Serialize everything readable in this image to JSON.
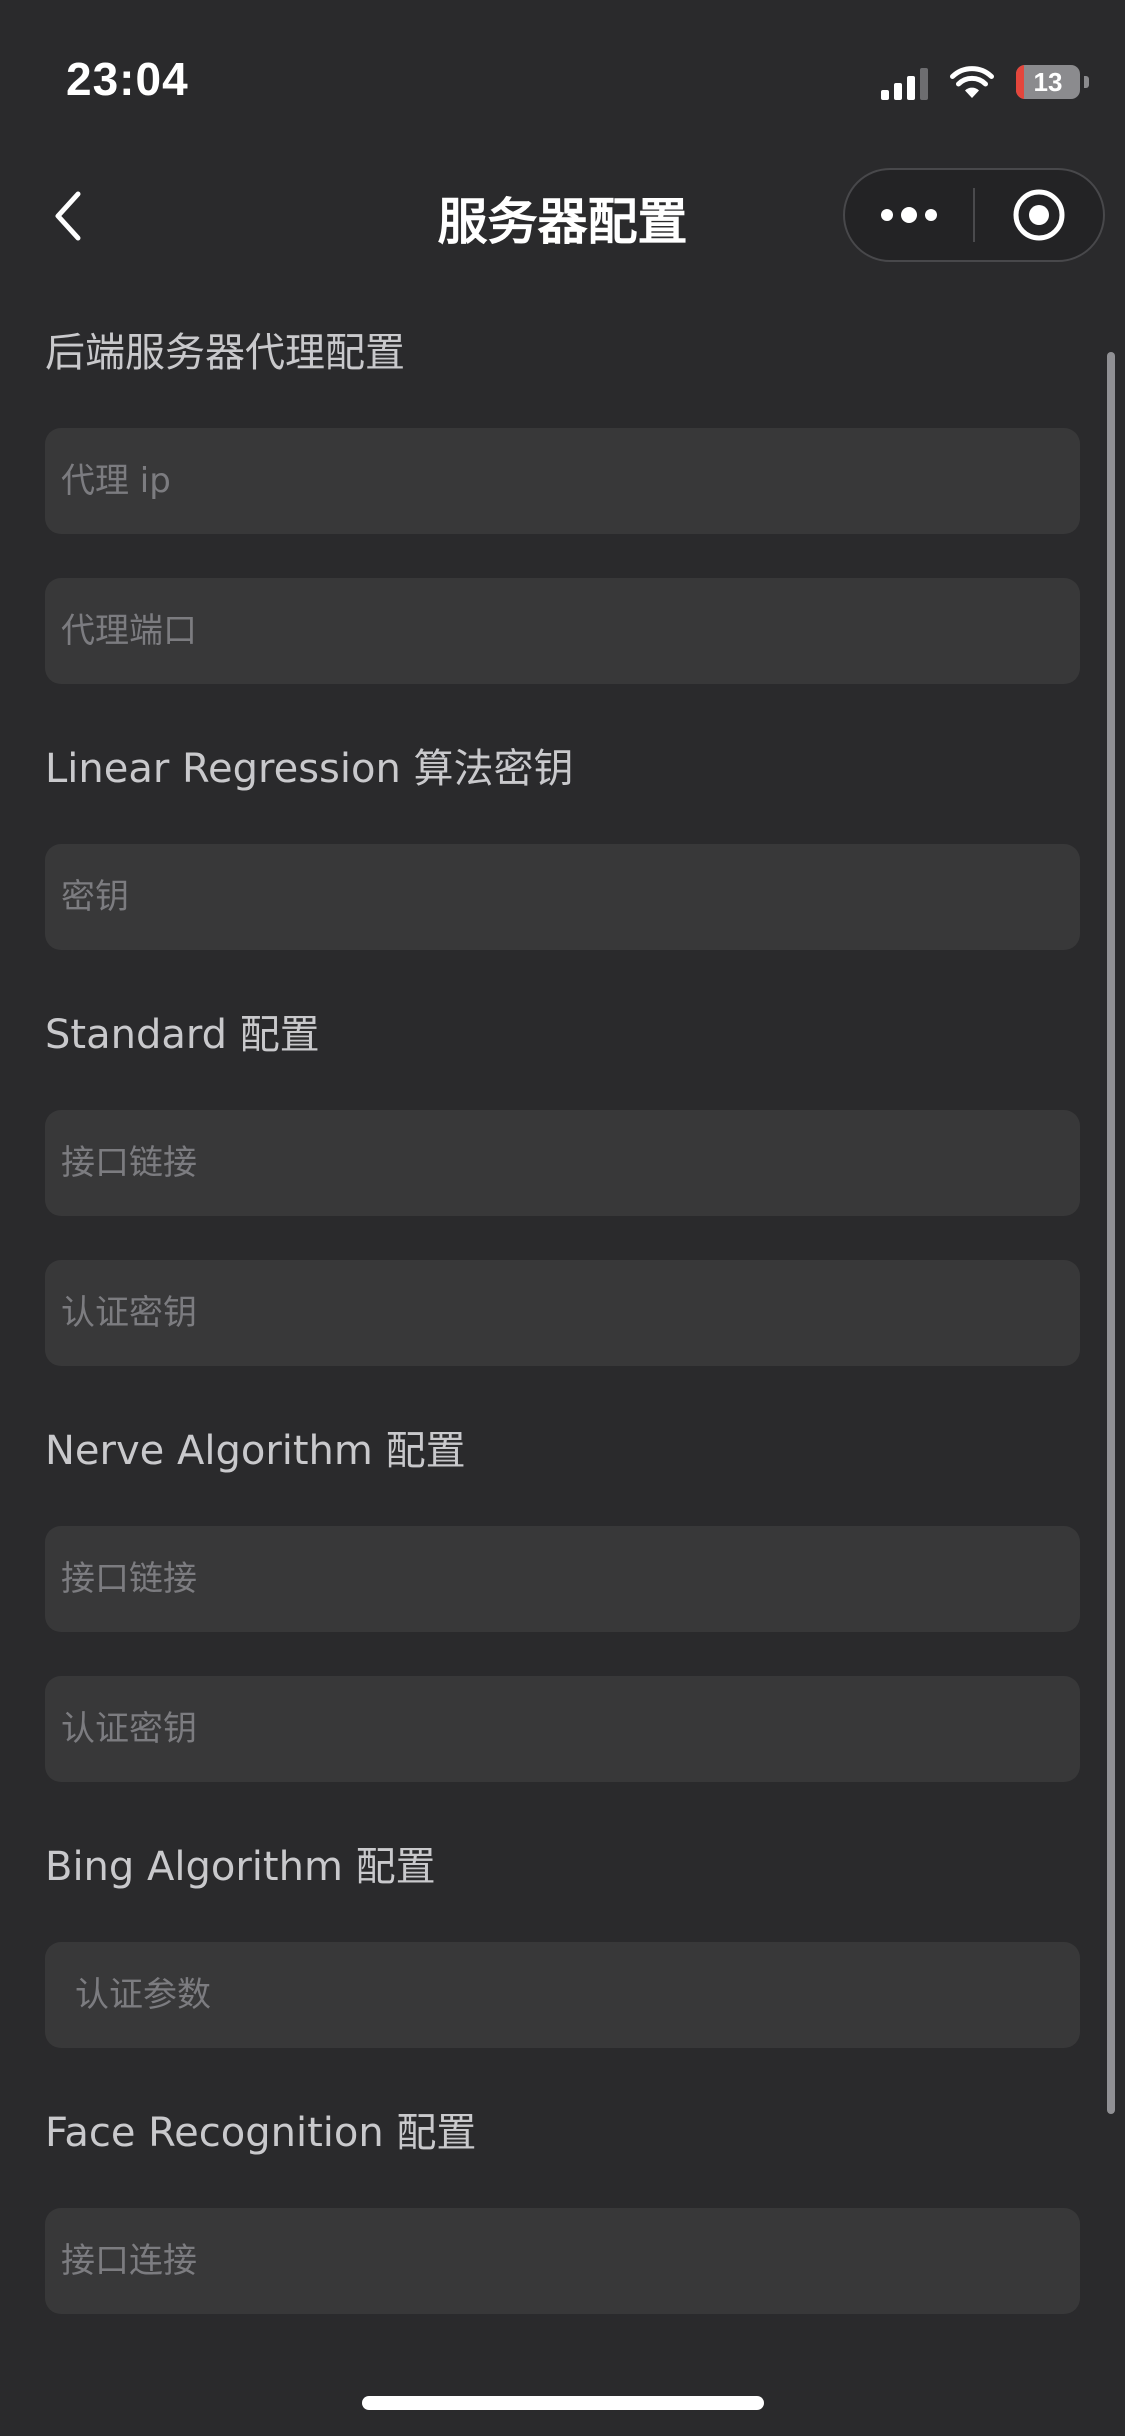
{
  "status_bar": {
    "time": "23:04",
    "battery_level": "13",
    "battery_fraction": 0.13,
    "signal_bars_active": 3,
    "signal_bars_total": 4,
    "icons": [
      "signal-icon",
      "wifi-icon",
      "battery-icon"
    ]
  },
  "nav": {
    "title": "服务器配置",
    "back_icon": "chevron-left-icon",
    "more_icon": "more-dots-icon",
    "close_icon": "target-close-icon"
  },
  "sections": {
    "proxy": {
      "title": "后端服务器代理配置",
      "ip_placeholder": "代理 ip",
      "port_placeholder": "代理端口"
    },
    "linear_regression": {
      "title": "Linear Regression 算法密钥",
      "key_placeholder": "密钥"
    },
    "standard": {
      "title": "Standard 配置",
      "url_placeholder": "接口链接",
      "key_placeholder": "认证密钥"
    },
    "nerve": {
      "title": "Nerve Algorithm 配置",
      "url_placeholder": "接口链接",
      "key_placeholder": "认证密钥"
    },
    "bing": {
      "title": "Bing Algorithm 配置",
      "param_placeholder": "认证参数"
    },
    "face": {
      "title": "Face Recognition 配置",
      "url_placeholder": "接口连接"
    }
  },
  "colors": {
    "background": "#2a2a2c",
    "input_background": "#383839",
    "battery_low": "#e4463c"
  }
}
